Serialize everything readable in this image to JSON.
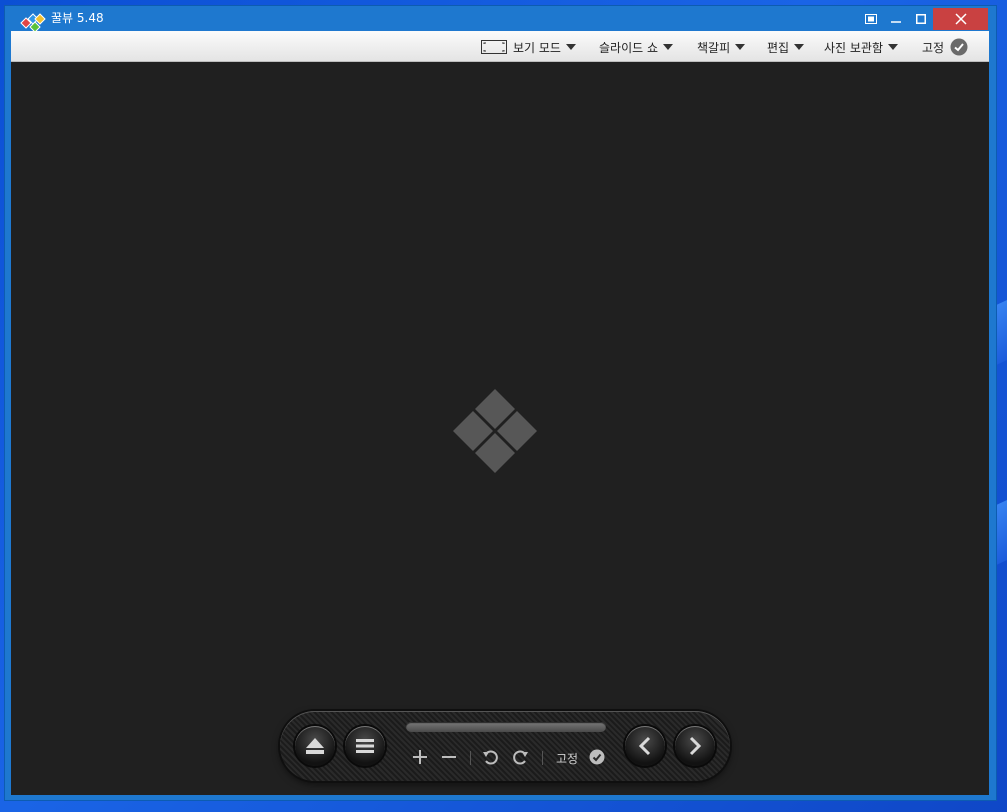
{
  "window": {
    "title": "꿀뷰 5.48"
  },
  "menu": [
    {
      "id": "view-mode",
      "label": "보기 모드"
    },
    {
      "id": "slideshow",
      "label": "슬라이드 쇼"
    },
    {
      "id": "bookmark",
      "label": "책갈피"
    },
    {
      "id": "edit",
      "label": "편집"
    },
    {
      "id": "photo-album",
      "label": "사진 보관함"
    }
  ],
  "pin": {
    "label": "고정"
  },
  "controller": {
    "pin_label": "고정"
  },
  "colors": {
    "titlebar": "#1e78cf",
    "close": "#c94141",
    "viewer_bg": "#202020"
  }
}
